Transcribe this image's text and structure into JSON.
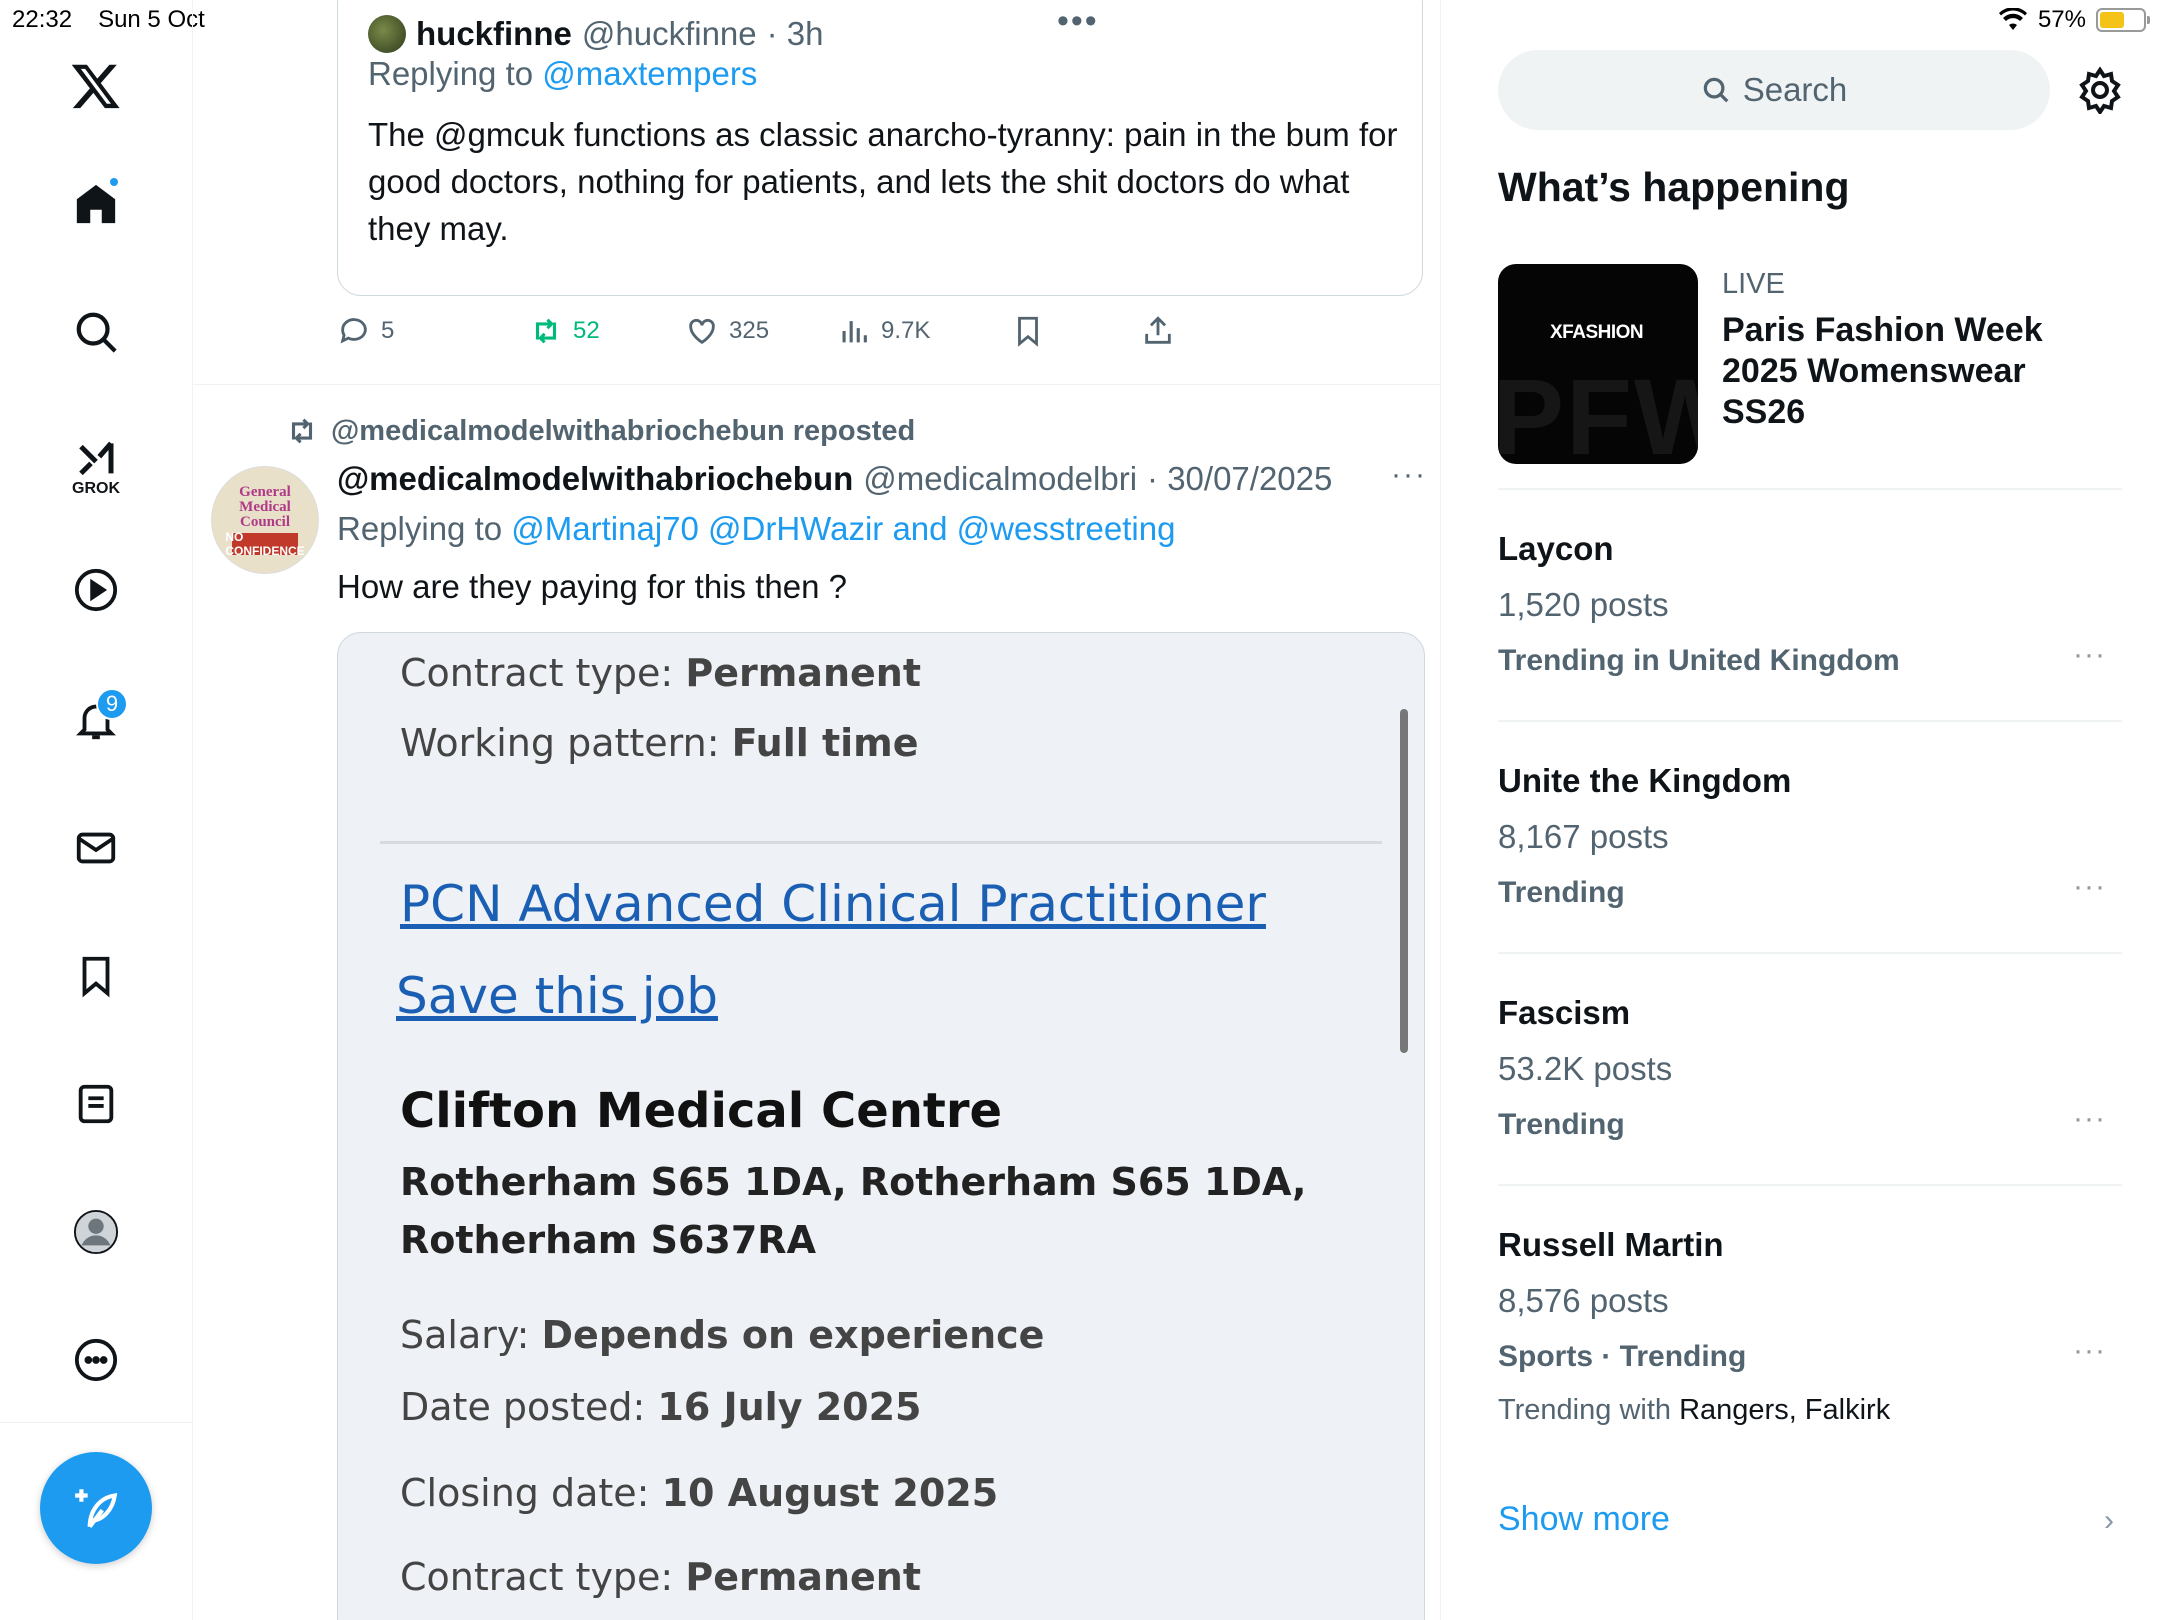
{
  "status": {
    "time": "22:32",
    "date": "Sun 5 Oct",
    "battery": "57%",
    "battery_level": 0.57
  },
  "nav": {
    "grok_label": "GROK",
    "notifications_badge": "9"
  },
  "quoted_post": {
    "name": "huckfinne",
    "handle": "@huckfinne",
    "time": "· 3h",
    "replying_prefix": "Replying to",
    "replying_to": "@maxtempers",
    "text": "The @gmcuk functions as classic anarcho-tyranny: pain in the bum for good doctors, nothing for patients, and lets the shit doctors do what they may.",
    "more": "•••"
  },
  "actions": {
    "replies": "5",
    "reposts": "52",
    "likes": "325",
    "views": "9.7K"
  },
  "post": {
    "repost_line": "@medicalmodelwithabriochebun reposted",
    "name": "@medicalmodelwithabriochebun",
    "handle": "@medicalmodelbri",
    "date": "· 30/07/2025",
    "more": "···",
    "replying_prefix": "Replying to",
    "replying_to": "@Martinaj70 @DrHWazir and @wesstreeting",
    "text": "How are they paying for this then ?",
    "avatar_text": [
      "General",
      "Medical",
      "Council"
    ],
    "avatar_sign": "NO CONFIDENCE"
  },
  "media": {
    "contract_label": "Contract type:",
    "contract_value": "Permanent",
    "pattern_label": "Working pattern:",
    "pattern_value": "Full time",
    "job_title": "PCN Advanced Clinical Practitioner",
    "save_job": "Save this job",
    "employer": "Clifton Medical Centre",
    "address_line1": "Rotherham S65 1DA, Rotherham S65 1DA,",
    "address_line2": "Rotherham S637RA",
    "salary_label": "Salary:",
    "salary_value": "Depends on experience",
    "posted_label": "Date posted:",
    "posted_value": "16 July 2025",
    "closing_label": "Closing date:",
    "closing_value": "10 August 2025",
    "contract2_label": "Contract type:",
    "contract2_value": "Permanent"
  },
  "sidebar": {
    "search_placeholder": "Search",
    "section_title": "What’s happening",
    "live": {
      "tag": "LIVE",
      "title": "Paris Fashion Week 2025 Womenswear SS26",
      "image_brand": "XFASHION",
      "image_bg_text": "PFW"
    },
    "trends": [
      {
        "name": "Laycon",
        "count": "1,520 posts",
        "context": "Trending in United Kingdom"
      },
      {
        "name": "Unite the Kingdom",
        "count": "8,167 posts",
        "context": "Trending"
      },
      {
        "name": "Fascism",
        "count": "53.2K posts",
        "context": "Trending"
      },
      {
        "name": "Russell Martin",
        "count": "8,576 posts",
        "context": "Sports · Trending",
        "with_prefix": "Trending with",
        "with_value": "Rangers, Falkirk"
      }
    ],
    "trend_more": "···",
    "show_more": "Show more"
  },
  "colors": {
    "accent": "#1d9bf0",
    "repost_green": "#00ba7c",
    "muted": "#536471"
  }
}
